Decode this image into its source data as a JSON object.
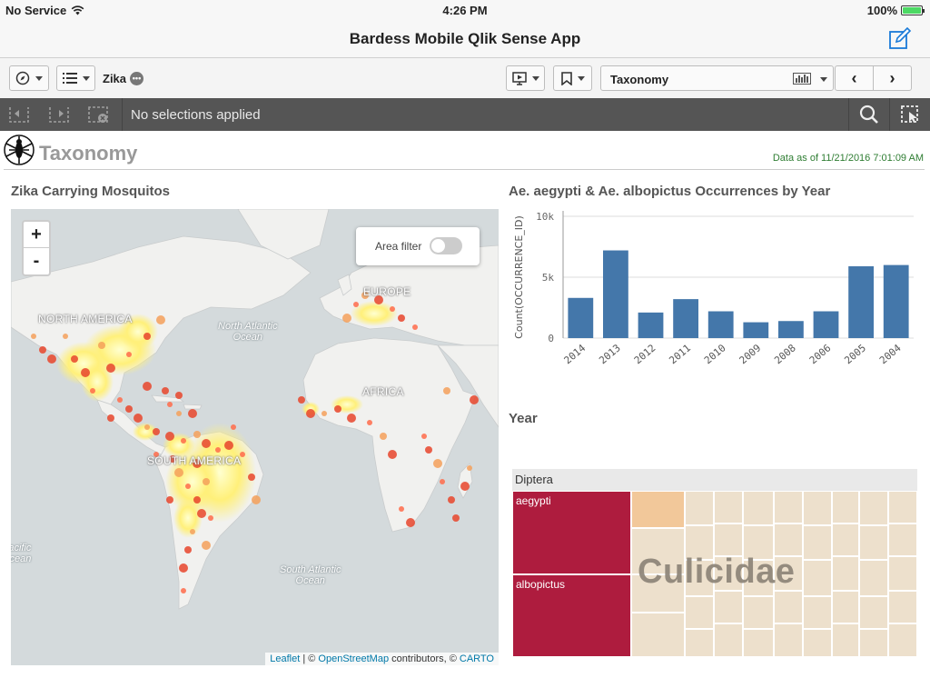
{
  "status_bar": {
    "carrier": "No Service",
    "time": "4:26 PM",
    "battery": "100%"
  },
  "nav": {
    "title": "Bardess Mobile Qlik Sense App"
  },
  "toolbar": {
    "app_name": "Zika",
    "app_menu_glyph": "•••",
    "sheet_name": "Taxonomy",
    "prev_glyph": "‹",
    "next_glyph": "›"
  },
  "selections": {
    "text": "No selections applied"
  },
  "sheet": {
    "title": "Taxonomy",
    "data_as_of": "Data as of 11/21/2016 7:01:09 AM"
  },
  "map": {
    "title": "Zika Carrying Mosquitos",
    "zoom_in": "+",
    "zoom_out": "-",
    "area_filter_label": "Area filter",
    "area_filter_on": false,
    "labels": {
      "north_america": "NORTH AMERICA",
      "europe": "EUROPE",
      "africa": "AFRICA",
      "south_america": "SOUTH AMERICA"
    },
    "oceans": {
      "north_atlantic": "North Atlantic\nOcean",
      "south_atlantic": "South Atlantic\nOcean",
      "pacific": "Pacific\nOcean"
    },
    "attribution": {
      "leaflet": "Leaflet",
      "sep1": " | © ",
      "osm": "OpenStreetMap",
      "mid": " contributors, © ",
      "carto": "CARTO"
    }
  },
  "bar_chart": {
    "title": "Ae. aegypti & Ae. albopictus Occurrences by Year",
    "color": "#4477aa"
  },
  "chart_data": {
    "type": "bar",
    "categories": [
      "2014",
      "2013",
      "2012",
      "2011",
      "2010",
      "2009",
      "2008",
      "2006",
      "2005",
      "2004"
    ],
    "values": [
      3300,
      7200,
      2100,
      3200,
      2200,
      1300,
      1400,
      2200,
      5900,
      6000
    ],
    "ylabel": "Count(OCCURRENCE_ID)",
    "xlabel": "Year",
    "ylim": [
      0,
      10000
    ],
    "yticks": [
      0,
      5000,
      10000
    ],
    "ytick_labels": [
      "0",
      "5k",
      "10k"
    ],
    "grid": true
  },
  "treemap": {
    "root": "Diptera",
    "family": "Culicidae",
    "leaves": [
      {
        "label": "aegypti",
        "color": "#ae1c3e"
      },
      {
        "label": "albopictus",
        "color": "#ae1c3e"
      }
    ],
    "highlight_color": "#f2c89a",
    "other_color": "#ede0cc"
  }
}
